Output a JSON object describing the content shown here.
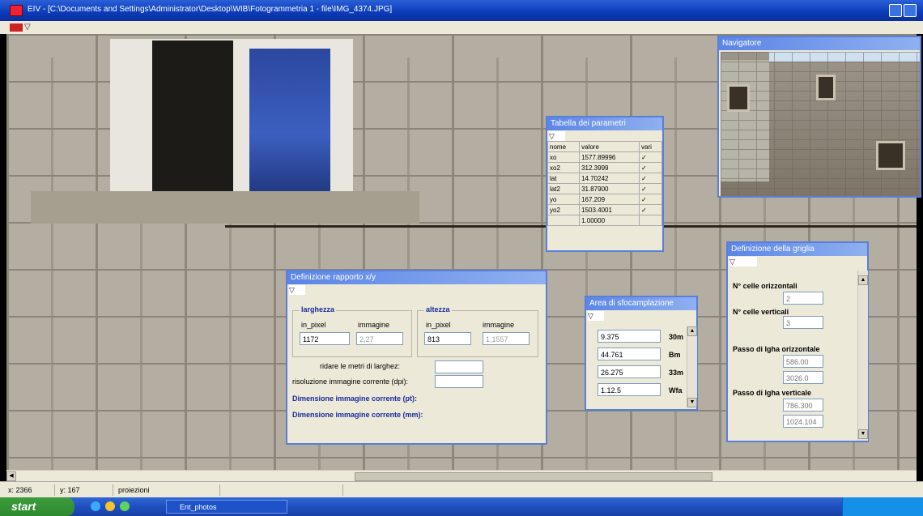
{
  "window": {
    "title": "EIV - [C:\\Documents and Settings\\Administrator\\Desktop\\WIB\\Fotogrammetria 1 - file\\IMG_4374.JPG]",
    "menu_icon_label": "▽"
  },
  "navigator": {
    "title": "Navigatore"
  },
  "params_table": {
    "title": "Tabella dei parametri",
    "toolbar": "▽",
    "columns": [
      "nome",
      "valore",
      "vari"
    ],
    "rows": [
      {
        "name": "xo",
        "value": "1577.89996",
        "vari": "✓"
      },
      {
        "name": "xo2",
        "value": "312.3999",
        "vari": "✓"
      },
      {
        "name": "lat",
        "value": "14.70242",
        "vari": "✓"
      },
      {
        "name": "lat2",
        "value": "31.87900",
        "vari": "✓"
      },
      {
        "name": "yo",
        "value": "167.209",
        "vari": "✓"
      },
      {
        "name": "yo2",
        "value": "1503.4001",
        "vari": "✓"
      },
      {
        "name": "",
        "value": "1.00000",
        "vari": ""
      }
    ]
  },
  "dimension_dialog": {
    "title": "Definizione rapporto x/y",
    "toolbar": "▽",
    "width_group": "larghezza",
    "height_group": "altezza",
    "px_label": "in_pixel",
    "image_label": "immagine",
    "width_px": "1172",
    "width_img": "2,27",
    "height_px": "813",
    "height_img": "1,1557",
    "label_fit": "ridare le metri di larghez:",
    "label_scale": "risoluzione immagine corrente (dpi):",
    "label_cm_px": "Dimensione immagine corrente (pt):",
    "label_cm_mm": "Dimensione immagine corrente (mm):"
  },
  "area_panel": {
    "title": "Area di sfocamplazione",
    "toolbar": "▽",
    "rows": [
      {
        "value": "9.375",
        "unit": "30m"
      },
      {
        "value": "44.761",
        "unit": "Bm"
      },
      {
        "value": "26.275",
        "unit": "33m"
      },
      {
        "value": "1.12.5",
        "unit": "Wfa"
      }
    ]
  },
  "grid_panel": {
    "title": "Definizione della griglia",
    "toolbar": "▽",
    "label_cols": "N° celle orizzontali",
    "cols_value": "2",
    "label_rows": "N° celle verticali",
    "rows_value": "3",
    "label_h_step": "Passo di lgha orizzontale",
    "h_step_1": "586.00",
    "h_step_2": "3026.0",
    "label_v_step": "Passo di lgha verticale",
    "v_step_1": "786.300",
    "v_step_2": "1024.104"
  },
  "statusbar": {
    "x": "x: 2366",
    "y": "y: 167",
    "mode": "proiezioni"
  },
  "taskbar": {
    "start_label": "start",
    "task_label": "Ent_photos",
    "colors": {
      "start": "#2e8a2e",
      "bar": "#1f4fbf"
    }
  }
}
